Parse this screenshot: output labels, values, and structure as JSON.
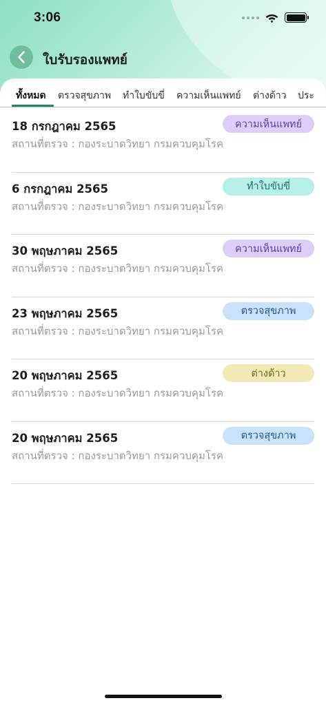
{
  "status_bar": {
    "time": "3:06"
  },
  "header": {
    "title": "ใบรับรองแพทย์"
  },
  "tabs": [
    {
      "label": "ทั้งหมด",
      "active": true
    },
    {
      "label": "ตรวจสุขภาพ",
      "active": false
    },
    {
      "label": "ทำใบขับขี่",
      "active": false
    },
    {
      "label": "ความเห็นแพทย์",
      "active": false
    },
    {
      "label": "ต่างด้าว",
      "active": false
    },
    {
      "label": "ประ",
      "active": false
    }
  ],
  "records": [
    {
      "date": "18 กรกฎาคม 2565",
      "place": "สถานที่ตรวจ : กองระบาดวิทยา กรมควบคุมโรค",
      "type": "ความเห็นแพทย์",
      "type_key": "opinion"
    },
    {
      "date": "6 กรกฎาคม 2565",
      "place": "สถานที่ตรวจ : กองระบาดวิทยา กรมควบคุมโรค",
      "type": "ทำใบขับขี่",
      "type_key": "license"
    },
    {
      "date": "30 พฤษภาคม 2565",
      "place": "สถานที่ตรวจ : กองระบาดวิทยา กรมควบคุมโรค",
      "type": "ความเห็นแพทย์",
      "type_key": "opinion"
    },
    {
      "date": "23 พฤษภาคม 2565",
      "place": "สถานที่ตรวจ : กองระบาดวิทยา กรมควบคุมโรค",
      "type": "ตรวจสุขภาพ",
      "type_key": "checkup"
    },
    {
      "date": "20 พฤษภาคม 2565",
      "place": "สถานที่ตรวจ : กองระบาดวิทยา กรมควบคุมโรค",
      "type": "ต่างด้าว",
      "type_key": "foreign"
    },
    {
      "date": "20 พฤษภาคม 2565",
      "place": "สถานที่ตรวจ : กองระบาดวิทยา กรมควบคุมโรค",
      "type": "ตรวจสุขภาพ",
      "type_key": "checkup"
    }
  ],
  "colors": {
    "accent": "#1f8a5e",
    "back_button": "#6fbf9c",
    "badge_opinion": "#dccdf9",
    "badge_license": "#b4f0e6",
    "badge_checkup": "#c8e2fb",
    "badge_foreign": "#f3e9b5"
  },
  "icons": {
    "back": "chevron-left-icon",
    "wifi": "wifi-icon",
    "battery": "battery-icon",
    "signal": "cellular-signal-icon"
  }
}
